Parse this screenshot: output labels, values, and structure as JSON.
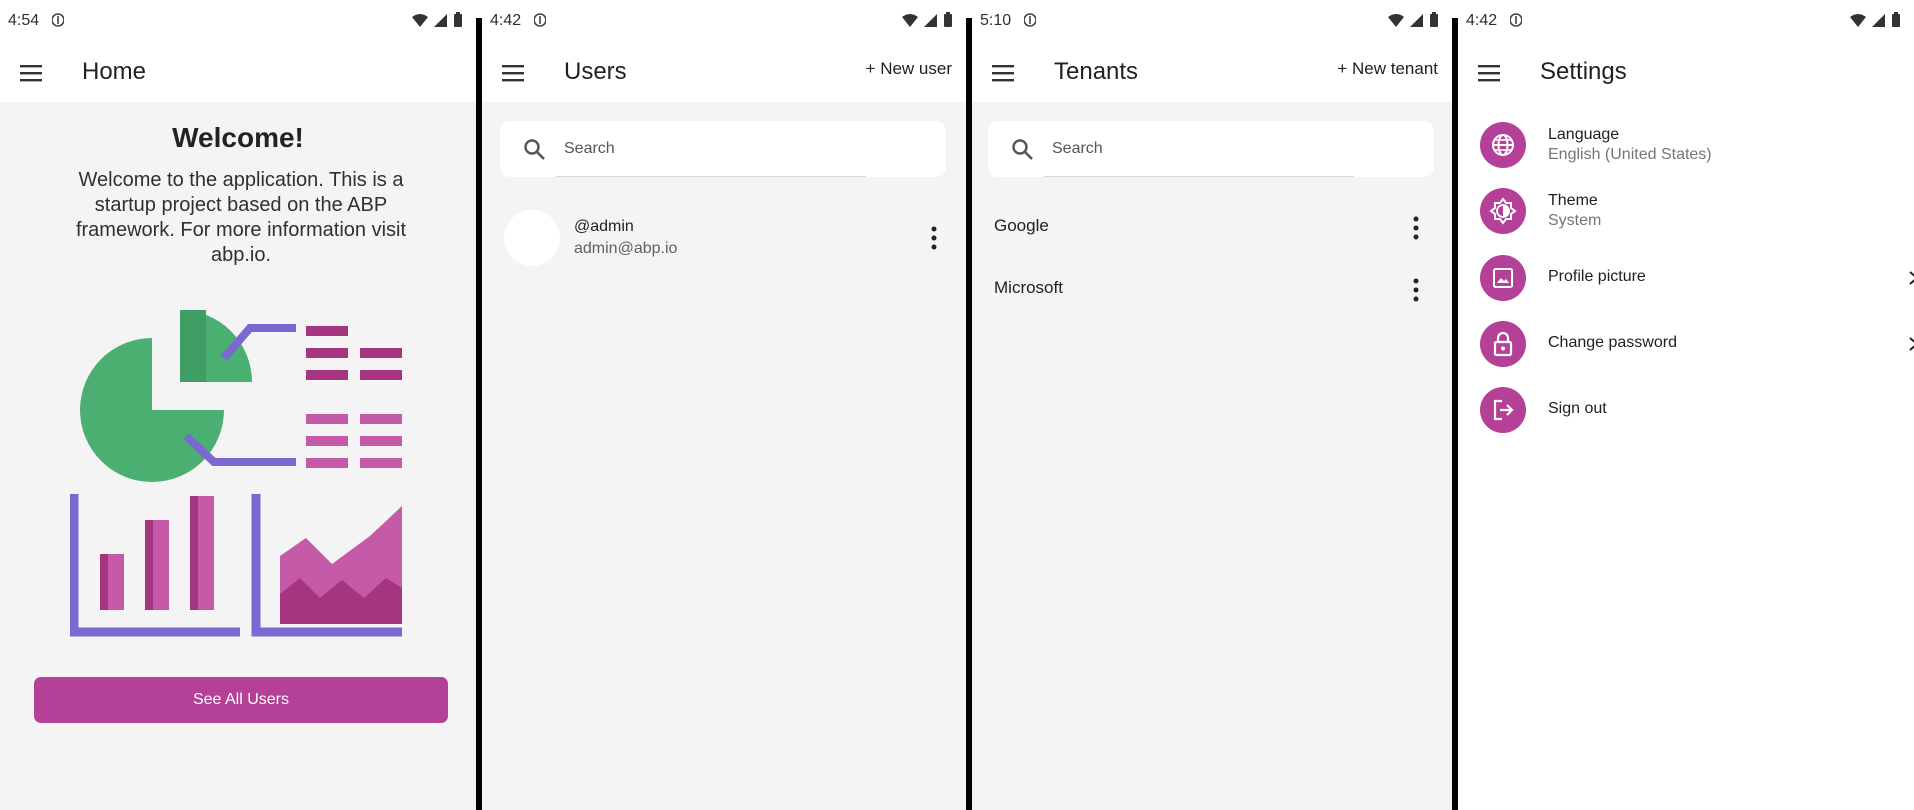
{
  "colors": {
    "accent": "#b44098",
    "background": "#f4f4f4",
    "surface": "#ffffff",
    "green": "#4caf72",
    "purple": "#7b68d0"
  },
  "home": {
    "status_time": "4:54",
    "title": "Home",
    "welcome_title": "Welcome!",
    "welcome_text": "Welcome to the application. This is a startup project based on the ABP framework. For more information visit abp.io.",
    "button_label": "See All Users"
  },
  "users": {
    "status_time": "4:42",
    "title": "Users",
    "action": "+ New user",
    "search_placeholder": "Search",
    "items": [
      {
        "username": "@admin",
        "email": "admin@abp.io"
      }
    ]
  },
  "tenants": {
    "status_time": "5:10",
    "title": "Tenants",
    "action": "+ New tenant",
    "search_placeholder": "Search",
    "items": [
      {
        "name": "Google"
      },
      {
        "name": "Microsoft"
      }
    ]
  },
  "settings": {
    "status_time": "4:42",
    "title": "Settings",
    "items": [
      {
        "label": "Language",
        "sub": "English (United States)",
        "icon": "globe-icon"
      },
      {
        "label": "Theme",
        "sub": "System",
        "icon": "brightness-icon"
      },
      {
        "label": "Profile picture",
        "icon": "image-icon"
      },
      {
        "label": "Change password",
        "icon": "lock-icon"
      },
      {
        "label": "Sign out",
        "icon": "logout-icon"
      }
    ]
  }
}
